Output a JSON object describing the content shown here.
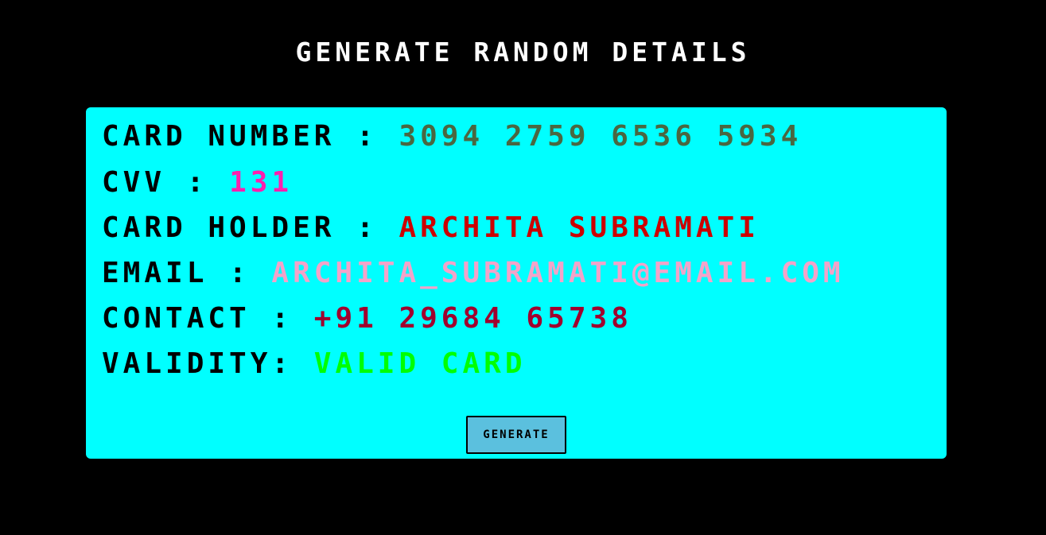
{
  "page": {
    "title": "GENERATE RANDOM DETAILS"
  },
  "details": {
    "card_number": {
      "label": "CARD NUMBER :",
      "value": "3094 2759 6536 5934",
      "color": "#4a6741"
    },
    "cvv": {
      "label": "CVV :",
      "value": "131",
      "color": "#ff1fae"
    },
    "card_holder": {
      "label": "CARD HOLDER :",
      "value": "ARCHITA SUBRAMATI",
      "color": "#cc0000"
    },
    "email": {
      "label": "EMAIL :",
      "value": "ARCHITA_SUBRAMATI@EMAIL.COM",
      "color": "#f3a3c9"
    },
    "contact": {
      "label": "CONTACT :",
      "value": "+91 29684 65738",
      "color": "#a0002e"
    },
    "validity": {
      "label": "VALIDITY:",
      "value": "VALID CARD",
      "color": "#00ff00"
    }
  },
  "actions": {
    "generate_label": "GENERATE",
    "button_color": "#5bc0de"
  },
  "theme": {
    "background": "#000000",
    "panel_background": "#00ffff",
    "title_color": "#ffffff"
  }
}
